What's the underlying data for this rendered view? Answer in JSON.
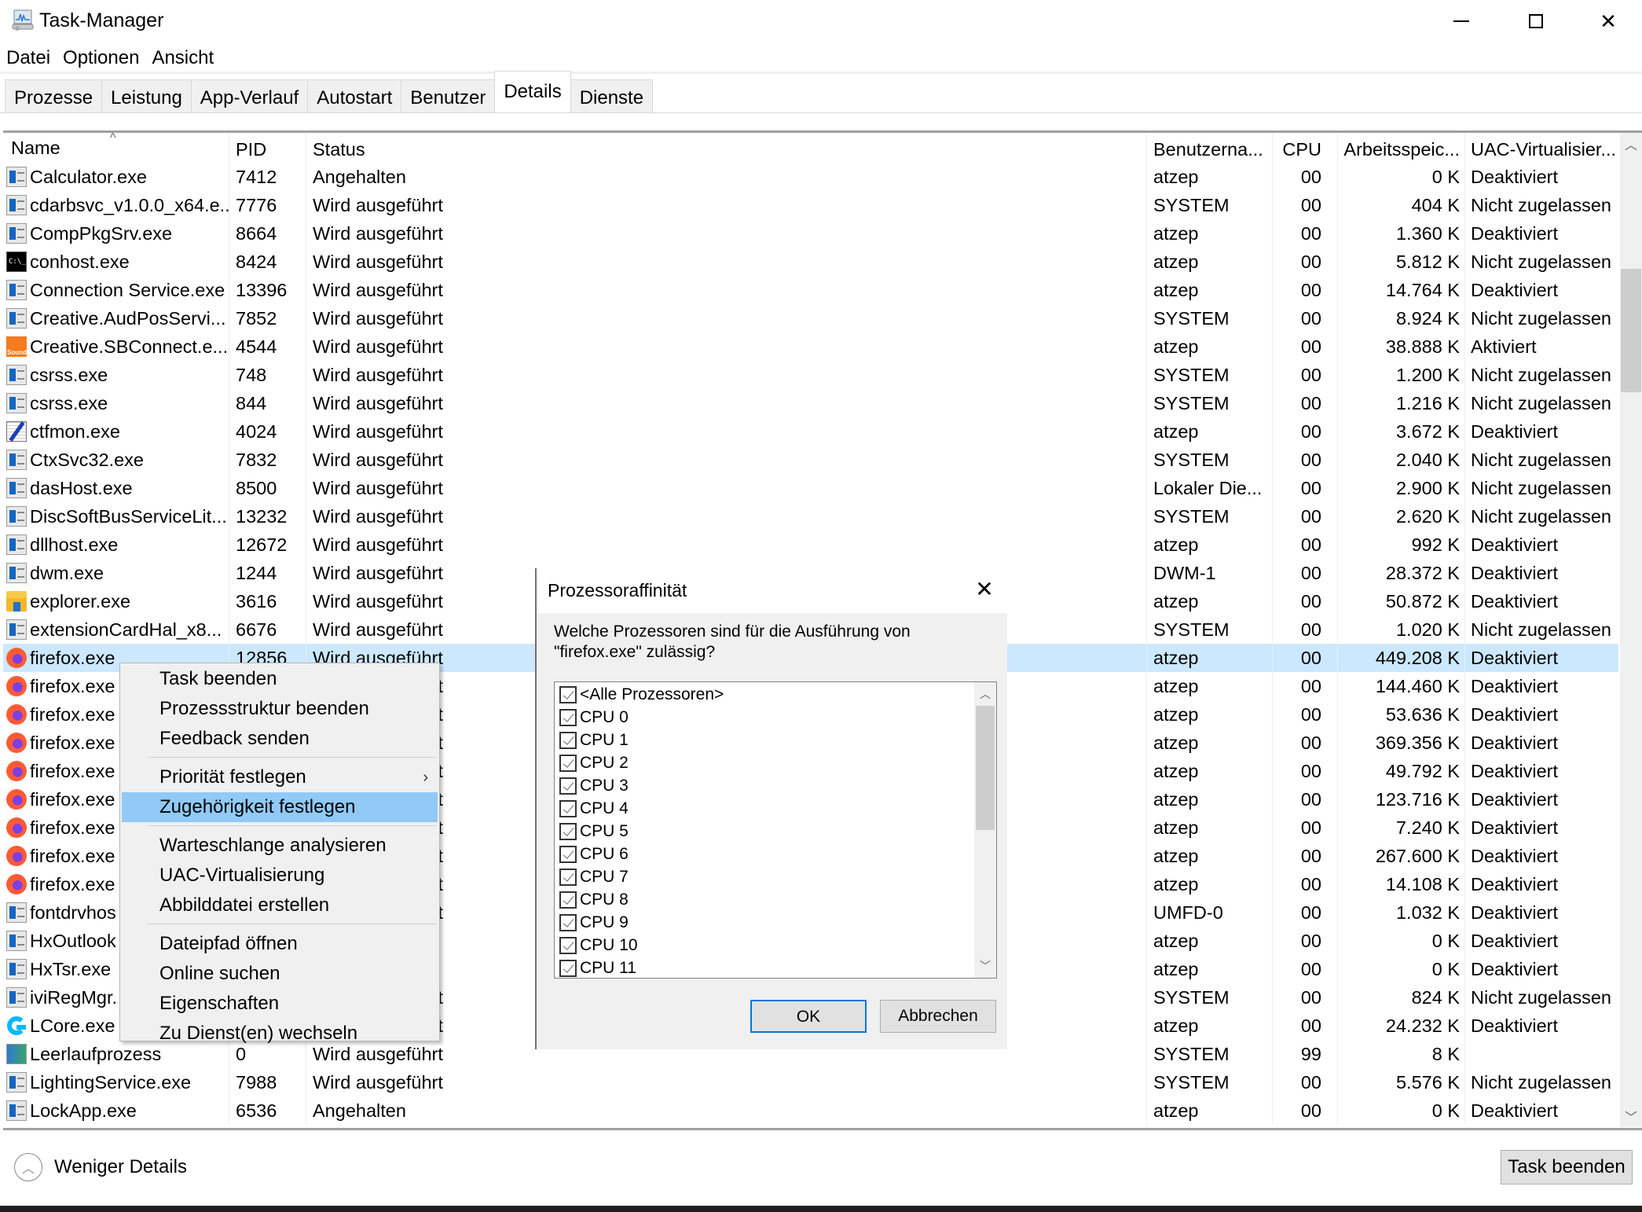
{
  "window": {
    "title": "Task-Manager",
    "app_icon": "task-manager-icon",
    "controls": [
      "minimize",
      "maximize",
      "close"
    ]
  },
  "menubar": [
    "Datei",
    "Optionen",
    "Ansicht"
  ],
  "tabs": [
    {
      "label": "Prozesse",
      "active": false
    },
    {
      "label": "Leistung",
      "active": false
    },
    {
      "label": "App-Verlauf",
      "active": false
    },
    {
      "label": "Autostart",
      "active": false
    },
    {
      "label": "Benutzer",
      "active": false
    },
    {
      "label": "Details",
      "active": true
    },
    {
      "label": "Dienste",
      "active": false
    }
  ],
  "table": {
    "sort_column": "Name",
    "sort_direction": "ascending",
    "columns": [
      "Name",
      "PID",
      "Status",
      "Benutzerna...",
      "CPU",
      "Arbeitsspeic...",
      "UAC-Virtualisier..."
    ],
    "selected_index": 17,
    "scroll": {
      "thumb_start": 0.12,
      "thumb_size": 0.13
    },
    "rows": [
      {
        "icon": "app",
        "name": "Calculator.exe",
        "pid": "7412",
        "status": "Angehalten",
        "user": "atzep",
        "cpu": "00",
        "mem": "0 K",
        "uac": "Deaktiviert"
      },
      {
        "icon": "app",
        "name": "cdarbsvc_v1.0.0_x64.e...",
        "pid": "7776",
        "status": "Wird ausgeführt",
        "user": "SYSTEM",
        "cpu": "00",
        "mem": "404 K",
        "uac": "Nicht zugelassen"
      },
      {
        "icon": "app",
        "name": "CompPkgSrv.exe",
        "pid": "8664",
        "status": "Wird ausgeführt",
        "user": "atzep",
        "cpu": "00",
        "mem": "1.360 K",
        "uac": "Deaktiviert"
      },
      {
        "icon": "console",
        "name": "conhost.exe",
        "pid": "8424",
        "status": "Wird ausgeführt",
        "user": "atzep",
        "cpu": "00",
        "mem": "5.812 K",
        "uac": "Nicht zugelassen"
      },
      {
        "icon": "app",
        "name": "Connection Service.exe",
        "pid": "13396",
        "status": "Wird ausgeführt",
        "user": "atzep",
        "cpu": "00",
        "mem": "14.764 K",
        "uac": "Deaktiviert"
      },
      {
        "icon": "app",
        "name": "Creative.AudPosServi...",
        "pid": "7852",
        "status": "Wird ausgeführt",
        "user": "SYSTEM",
        "cpu": "00",
        "mem": "8.924 K",
        "uac": "Nicht zugelassen"
      },
      {
        "icon": "sound",
        "name": "Creative.SBConnect.e...",
        "pid": "4544",
        "status": "Wird ausgeführt",
        "user": "atzep",
        "cpu": "00",
        "mem": "38.888 K",
        "uac": "Aktiviert"
      },
      {
        "icon": "app",
        "name": "csrss.exe",
        "pid": "748",
        "status": "Wird ausgeführt",
        "user": "SYSTEM",
        "cpu": "00",
        "mem": "1.200 K",
        "uac": "Nicht zugelassen"
      },
      {
        "icon": "app",
        "name": "csrss.exe",
        "pid": "844",
        "status": "Wird ausgeführt",
        "user": "SYSTEM",
        "cpu": "00",
        "mem": "1.216 K",
        "uac": "Nicht zugelassen"
      },
      {
        "icon": "pen",
        "name": "ctfmon.exe",
        "pid": "4024",
        "status": "Wird ausgeführt",
        "user": "atzep",
        "cpu": "00",
        "mem": "3.672 K",
        "uac": "Deaktiviert"
      },
      {
        "icon": "app",
        "name": "CtxSvc32.exe",
        "pid": "7832",
        "status": "Wird ausgeführt",
        "user": "SYSTEM",
        "cpu": "00",
        "mem": "2.040 K",
        "uac": "Nicht zugelassen"
      },
      {
        "icon": "app",
        "name": "dasHost.exe",
        "pid": "8500",
        "status": "Wird ausgeführt",
        "user": "Lokaler Die...",
        "cpu": "00",
        "mem": "2.900 K",
        "uac": "Nicht zugelassen"
      },
      {
        "icon": "app",
        "name": "DiscSoftBusServiceLit...",
        "pid": "13232",
        "status": "Wird ausgeführt",
        "user": "SYSTEM",
        "cpu": "00",
        "mem": "2.620 K",
        "uac": "Nicht zugelassen"
      },
      {
        "icon": "app",
        "name": "dllhost.exe",
        "pid": "12672",
        "status": "Wird ausgeführt",
        "user": "atzep",
        "cpu": "00",
        "mem": "992 K",
        "uac": "Deaktiviert"
      },
      {
        "icon": "app",
        "name": "dwm.exe",
        "pid": "1244",
        "status": "Wird ausgeführt",
        "user": "DWM-1",
        "cpu": "00",
        "mem": "28.372 K",
        "uac": "Deaktiviert"
      },
      {
        "icon": "folder",
        "name": "explorer.exe",
        "pid": "3616",
        "status": "Wird ausgeführt",
        "user": "atzep",
        "cpu": "00",
        "mem": "50.872 K",
        "uac": "Deaktiviert"
      },
      {
        "icon": "app",
        "name": "extensionCardHal_x8...",
        "pid": "6676",
        "status": "Wird ausgeführt",
        "user": "SYSTEM",
        "cpu": "00",
        "mem": "1.020 K",
        "uac": "Nicht zugelassen"
      },
      {
        "icon": "firefox",
        "name": "firefox.exe",
        "pid": "12856",
        "status": "Wird ausgeführt",
        "user": "atzep",
        "cpu": "00",
        "mem": "449.208 K",
        "uac": "Deaktiviert"
      },
      {
        "icon": "firefox",
        "name": "firefox.exe",
        "pid": "",
        "status": "Wird ausgeführt",
        "user": "atzep",
        "cpu": "00",
        "mem": "144.460 K",
        "uac": "Deaktiviert"
      },
      {
        "icon": "firefox",
        "name": "firefox.exe",
        "pid": "",
        "status": "Wird ausgeführt",
        "user": "atzep",
        "cpu": "00",
        "mem": "53.636 K",
        "uac": "Deaktiviert"
      },
      {
        "icon": "firefox",
        "name": "firefox.exe",
        "pid": "",
        "status": "Wird ausgeführt",
        "user": "atzep",
        "cpu": "00",
        "mem": "369.356 K",
        "uac": "Deaktiviert"
      },
      {
        "icon": "firefox",
        "name": "firefox.exe",
        "pid": "",
        "status": "Wird ausgeführt",
        "user": "atzep",
        "cpu": "00",
        "mem": "49.792 K",
        "uac": "Deaktiviert"
      },
      {
        "icon": "firefox",
        "name": "firefox.exe",
        "pid": "",
        "status": "Wird ausgeführt",
        "user": "atzep",
        "cpu": "00",
        "mem": "123.716 K",
        "uac": "Deaktiviert"
      },
      {
        "icon": "firefox",
        "name": "firefox.exe",
        "pid": "",
        "status": "Wird ausgeführt",
        "user": "atzep",
        "cpu": "00",
        "mem": "7.240 K",
        "uac": "Deaktiviert"
      },
      {
        "icon": "firefox",
        "name": "firefox.exe",
        "pid": "",
        "status": "Wird ausgeführt",
        "user": "atzep",
        "cpu": "00",
        "mem": "267.600 K",
        "uac": "Deaktiviert"
      },
      {
        "icon": "firefox",
        "name": "firefox.exe",
        "pid": "",
        "status": "Wird ausgeführt",
        "user": "atzep",
        "cpu": "00",
        "mem": "14.108 K",
        "uac": "Deaktiviert"
      },
      {
        "icon": "app",
        "name": "fontdrvhos",
        "pid": "",
        "status": "Wird ausgeführt",
        "user": "UMFD-0",
        "cpu": "00",
        "mem": "1.032 K",
        "uac": "Deaktiviert"
      },
      {
        "icon": "app",
        "name": "HxOutlook",
        "pid": "",
        "status": "",
        "user": "atzep",
        "cpu": "00",
        "mem": "0 K",
        "uac": "Deaktiviert"
      },
      {
        "icon": "app",
        "name": "HxTsr.exe",
        "pid": "",
        "status": "",
        "user": "atzep",
        "cpu": "00",
        "mem": "0 K",
        "uac": "Deaktiviert"
      },
      {
        "icon": "app",
        "name": "iviRegMgr.",
        "pid": "",
        "status": "Wird ausgeführt",
        "user": "SYSTEM",
        "cpu": "00",
        "mem": "824 K",
        "uac": "Nicht zugelassen"
      },
      {
        "icon": "logi",
        "name": "LCore.exe",
        "pid": "",
        "status": "Wird ausgeführt",
        "user": "atzep",
        "cpu": "00",
        "mem": "24.232 K",
        "uac": "Deaktiviert"
      },
      {
        "icon": "idle",
        "name": "Leerlaufprozess",
        "pid": "0",
        "status": "Wird ausgeführt",
        "user": "SYSTEM",
        "cpu": "99",
        "mem": "8 K",
        "uac": ""
      },
      {
        "icon": "app",
        "name": "LightingService.exe",
        "pid": "7988",
        "status": "Wird ausgeführt",
        "user": "SYSTEM",
        "cpu": "00",
        "mem": "5.576 K",
        "uac": "Nicht zugelassen"
      },
      {
        "icon": "app",
        "name": "LockApp.exe",
        "pid": "6536",
        "status": "Angehalten",
        "user": "atzep",
        "cpu": "00",
        "mem": "0 K",
        "uac": "Deaktiviert"
      }
    ]
  },
  "context_menu": {
    "items": [
      {
        "label": "Task beenden",
        "group": 0
      },
      {
        "label": "Prozessstruktur beenden",
        "group": 0
      },
      {
        "label": "Feedback senden",
        "group": 0
      },
      {
        "label": "Priorität festlegen",
        "group": 1,
        "submenu": true
      },
      {
        "label": "Zugehörigkeit festlegen",
        "group": 1,
        "highlighted": true
      },
      {
        "label": "Warteschlange analysieren",
        "group": 2
      },
      {
        "label": "UAC-Virtualisierung",
        "group": 2
      },
      {
        "label": "Abbilddatei erstellen",
        "group": 2
      },
      {
        "label": "Dateipfad öffnen",
        "group": 3
      },
      {
        "label": "Online suchen",
        "group": 3
      },
      {
        "label": "Eigenschaften",
        "group": 3
      },
      {
        "label": "Zu Dienst(en) wechseln",
        "group": 3
      }
    ]
  },
  "dialog": {
    "title": "Prozessoraffinität",
    "close_icon": "close-icon",
    "question": "Welche Prozessoren sind für die Ausführung von \"firefox.exe\" zulässig?",
    "processors": [
      {
        "label": "<Alle Prozessoren>",
        "checked": true
      },
      {
        "label": "CPU 0",
        "checked": true
      },
      {
        "label": "CPU 1",
        "checked": true
      },
      {
        "label": "CPU 2",
        "checked": true
      },
      {
        "label": "CPU 3",
        "checked": true
      },
      {
        "label": "CPU 4",
        "checked": true
      },
      {
        "label": "CPU 5",
        "checked": true
      },
      {
        "label": "CPU 6",
        "checked": true
      },
      {
        "label": "CPU 7",
        "checked": true
      },
      {
        "label": "CPU 8",
        "checked": true
      },
      {
        "label": "CPU 9",
        "checked": true
      },
      {
        "label": "CPU 10",
        "checked": true
      },
      {
        "label": "CPU 11",
        "checked": true
      }
    ],
    "list_scroll": {
      "thumb_start": 0.0,
      "thumb_size": 0.5
    },
    "ok_label": "OK",
    "cancel_label": "Abbrechen"
  },
  "footer": {
    "less_details_label": "Weniger Details",
    "end_task_label": "Task beenden"
  }
}
